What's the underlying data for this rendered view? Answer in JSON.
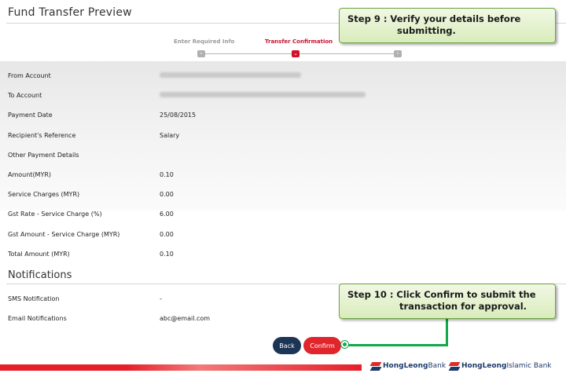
{
  "page": {
    "title": "Fund Transfer Preview"
  },
  "stepper": {
    "steps": [
      {
        "label": "Enter Required Info",
        "state": "done"
      },
      {
        "label": "Transfer Confirmation",
        "state": "active"
      },
      {
        "label": "",
        "state": "pending"
      }
    ],
    "active_color": "#c8102e"
  },
  "details": [
    {
      "label": "From Account",
      "value": "",
      "redacted": true
    },
    {
      "label": "To Account",
      "value": "",
      "redacted": true
    },
    {
      "label": "Payment Date",
      "value": "25/08/2015"
    },
    {
      "label": "Recipient's Reference",
      "value": "Salary"
    },
    {
      "label": "Other Payment Details",
      "value": ""
    },
    {
      "label": "Amount(MYR)",
      "value": "0.10"
    },
    {
      "label": "Service Charges (MYR)",
      "value": "0.00"
    },
    {
      "label": "Gst Rate - Service Charge (%)",
      "value": "6.00"
    },
    {
      "label": "Gst Amount - Service Charge (MYR)",
      "value": "0.00"
    },
    {
      "label": "Total Amount (MYR)",
      "value": "0.10"
    }
  ],
  "notifications": {
    "title": "Notifications",
    "rows": [
      {
        "label": "SMS Notification",
        "value": "-"
      },
      {
        "label": "Email Notifications",
        "value": "abc@email.com"
      }
    ]
  },
  "actions": {
    "back_label": "Back",
    "confirm_label": "Confirm"
  },
  "callouts": {
    "step9": {
      "line1": "Step 9 :  Verify your details before",
      "line2": "submitting."
    },
    "step10": {
      "line1": "Step 10 : Click Confirm to submit the",
      "line2": "transaction for approval."
    }
  },
  "footer": {
    "brand1_bold": "HongLeong",
    "brand1_light": " Bank",
    "brand2_bold": "HongLeong",
    "brand2_light": " Islamic Bank"
  },
  "colors": {
    "accent_red": "#e0262c",
    "navy": "#1c3557",
    "callout_border": "#6ea544",
    "connector": "#12a84a"
  }
}
